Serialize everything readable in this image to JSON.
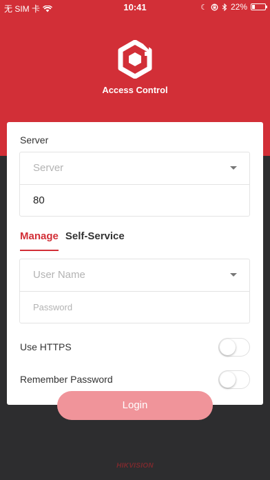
{
  "status_bar": {
    "carrier": "无 SIM 卡",
    "time": "10:41",
    "battery": "22%",
    "battery_level": 0.22
  },
  "app": {
    "title": "Access Control",
    "logo_icon": "hexagon-access-logo-icon",
    "brand": "HIKVISION"
  },
  "colors": {
    "brand_red": "#d22f37",
    "login_button": "#f0949a",
    "dark_background": "#2d2d2f"
  },
  "server": {
    "label": "Server",
    "placeholder": "Server",
    "port": "80"
  },
  "tabs": [
    {
      "label": "Manage",
      "active": true
    },
    {
      "label": "Self-Service",
      "active": false
    }
  ],
  "credentials": {
    "username_placeholder": "User Name",
    "password_placeholder": "Password"
  },
  "options": {
    "https_label": "Use HTTPS",
    "https_on": false,
    "remember_label": "Remember Password",
    "remember_on": false
  },
  "login": {
    "label": "Login"
  }
}
